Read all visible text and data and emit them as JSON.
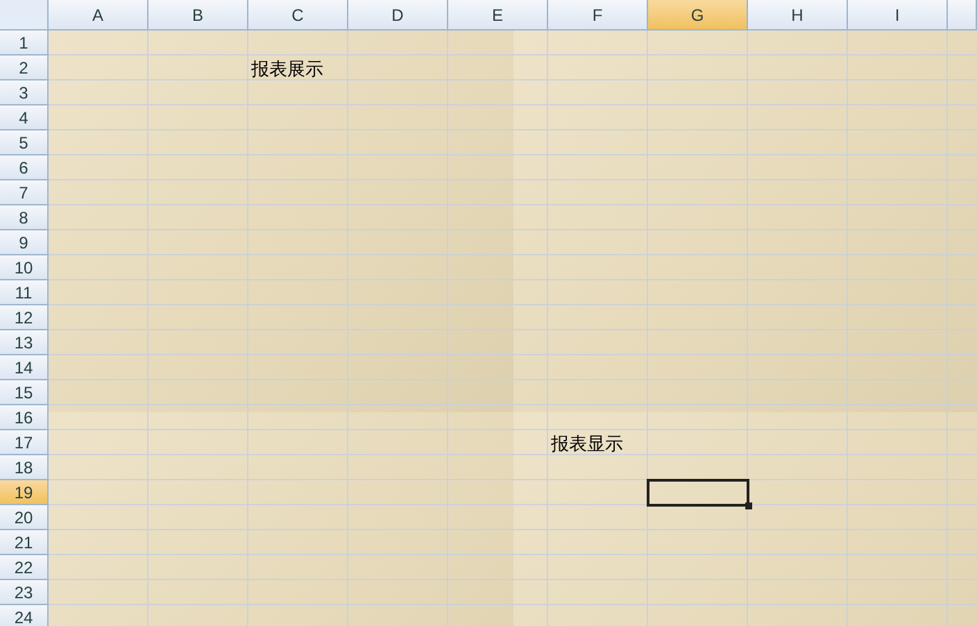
{
  "columns": [
    {
      "label": "A",
      "selected": false
    },
    {
      "label": "B",
      "selected": false
    },
    {
      "label": "C",
      "selected": false
    },
    {
      "label": "D",
      "selected": false
    },
    {
      "label": "E",
      "selected": false
    },
    {
      "label": "F",
      "selected": false
    },
    {
      "label": "G",
      "selected": true
    },
    {
      "label": "H",
      "selected": false
    },
    {
      "label": "I",
      "selected": false
    }
  ],
  "rows": [
    {
      "label": "1",
      "selected": false
    },
    {
      "label": "2",
      "selected": false,
      "cells": [
        null,
        null,
        "报表展示"
      ]
    },
    {
      "label": "3",
      "selected": false
    },
    {
      "label": "4",
      "selected": false
    },
    {
      "label": "5",
      "selected": false
    },
    {
      "label": "6",
      "selected": false
    },
    {
      "label": "7",
      "selected": false
    },
    {
      "label": "8",
      "selected": false
    },
    {
      "label": "9",
      "selected": false
    },
    {
      "label": "10",
      "selected": false
    },
    {
      "label": "11",
      "selected": false
    },
    {
      "label": "12",
      "selected": false
    },
    {
      "label": "13",
      "selected": false
    },
    {
      "label": "14",
      "selected": false
    },
    {
      "label": "15",
      "selected": false
    },
    {
      "label": "16",
      "selected": false
    },
    {
      "label": "17",
      "selected": false,
      "cells": [
        null,
        null,
        null,
        null,
        null,
        "报表显示"
      ]
    },
    {
      "label": "18",
      "selected": false
    },
    {
      "label": "19",
      "selected": true
    },
    {
      "label": "20",
      "selected": false
    },
    {
      "label": "21",
      "selected": false
    },
    {
      "label": "22",
      "selected": false
    },
    {
      "label": "23",
      "selected": false
    },
    {
      "label": "24",
      "selected": false
    }
  ]
}
